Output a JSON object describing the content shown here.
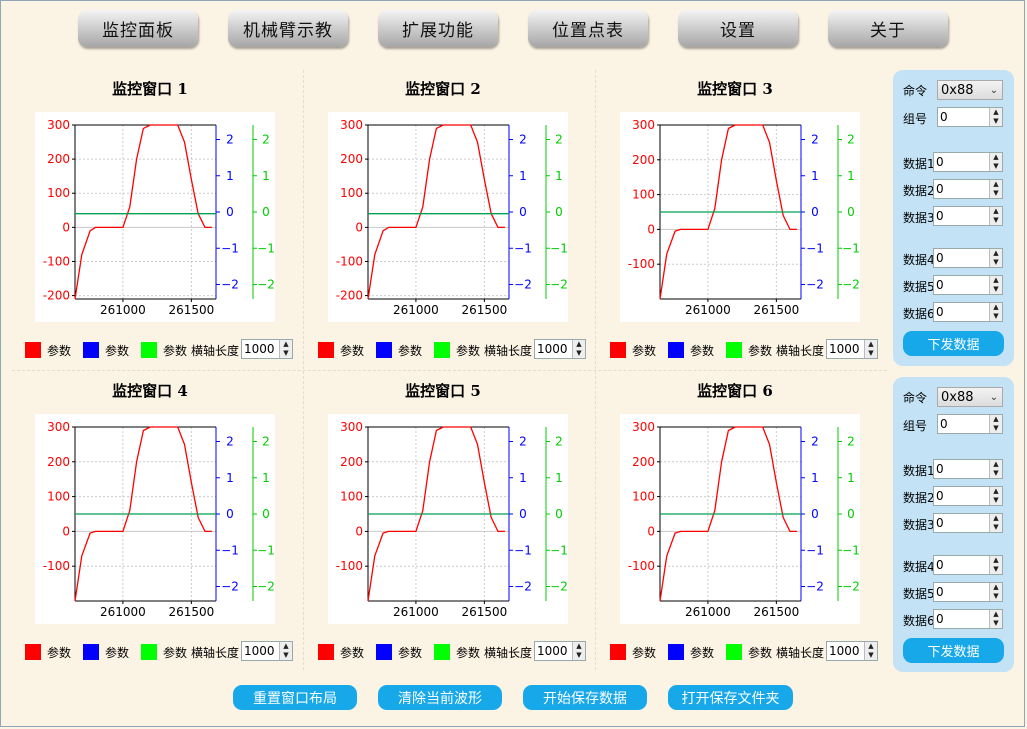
{
  "nav": [
    "监控面板",
    "机械臂示教",
    "扩展功能",
    "位置点表",
    "设置",
    "关于"
  ],
  "panels": [
    {
      "title": "监控窗口 1",
      "y_left": [
        "300",
        "200",
        "100",
        "0",
        "-100",
        "-200"
      ],
      "x_ticks": [
        "261000",
        "261500"
      ],
      "span": "1000"
    },
    {
      "title": "监控窗口 2",
      "y_left": [
        "300",
        "200",
        "100",
        "0",
        "-100",
        "-200"
      ],
      "x_ticks": [
        "261000",
        "261500"
      ],
      "span": "1000"
    },
    {
      "title": "监控窗口 3",
      "y_left": [
        "300",
        "200",
        "100",
        "0",
        "-100"
      ],
      "x_ticks": [
        "261000",
        "261500"
      ],
      "span": "1000"
    },
    {
      "title": "监控窗口 4",
      "y_left": [
        "300",
        "200",
        "100",
        "0",
        "-100"
      ],
      "x_ticks": [
        "261000",
        "261500"
      ],
      "span": "1000"
    },
    {
      "title": "监控窗口 5",
      "y_left": [
        "300",
        "200",
        "100",
        "0",
        "-100"
      ],
      "x_ticks": [
        "261000",
        "261500"
      ],
      "span": "1000"
    },
    {
      "title": "监控窗口 6",
      "y_left": [
        "300",
        "200",
        "100",
        "0",
        "-100"
      ],
      "x_ticks": [
        "261000",
        "261500"
      ],
      "span": "1000"
    }
  ],
  "legend": {
    "series": [
      "参数",
      "参数",
      "参数"
    ],
    "colors": [
      "#ff0000",
      "#0000ff",
      "#00ff00"
    ],
    "span_label": "横轴长度"
  },
  "axis_blue": [
    "2",
    "1",
    "0",
    "−1",
    "−2"
  ],
  "axis_green": [
    "2",
    "1",
    "0",
    "−1",
    "−2"
  ],
  "side_panels": [
    {
      "cmd_label": "命令",
      "cmd_value": "0x88",
      "group_label": "组号",
      "group_value": "0",
      "data": [
        {
          "label": "数据1",
          "value": "0"
        },
        {
          "label": "数据2",
          "value": "0"
        },
        {
          "label": "数据3",
          "value": "0"
        },
        {
          "label": "数据4",
          "value": "0"
        },
        {
          "label": "数据5",
          "value": "0"
        },
        {
          "label": "数据6",
          "value": "0"
        }
      ],
      "send": "下发数据"
    },
    {
      "cmd_label": "命令",
      "cmd_value": "0x88",
      "group_label": "组号",
      "group_value": "0",
      "data": [
        {
          "label": "数据1",
          "value": "0"
        },
        {
          "label": "数据2",
          "value": "0"
        },
        {
          "label": "数据3",
          "value": "0"
        },
        {
          "label": "数据4",
          "value": "0"
        },
        {
          "label": "数据5",
          "value": "0"
        },
        {
          "label": "数据6",
          "value": "0"
        }
      ],
      "send": "下发数据"
    }
  ],
  "bottom": [
    "重置窗口布局",
    "清除当前波形",
    "开始保存数据",
    "打开保存文件夹"
  ],
  "chart_data": [
    {
      "type": "line",
      "title": "监控窗口 1",
      "x_ticks": [
        261000,
        261500
      ],
      "xlim": [
        260650,
        261680
      ],
      "ylim": [
        -210,
        300
      ],
      "y2lim": [
        -2.4,
        2.4
      ],
      "series": [
        {
          "name": "参数",
          "color": "#ff0000",
          "points": [
            [
              260650,
              -210
            ],
            [
              260700,
              -80
            ],
            [
              260760,
              -10
            ],
            [
              260800,
              0
            ],
            [
              261000,
              0
            ],
            [
              261050,
              60
            ],
            [
              261100,
              200
            ],
            [
              261150,
              290
            ],
            [
              261200,
              300
            ],
            [
              261400,
              300
            ],
            [
              261450,
              250
            ],
            [
              261500,
              140
            ],
            [
              261550,
              40
            ],
            [
              261600,
              0
            ],
            [
              261650,
              0
            ]
          ]
        },
        {
          "name": "参数",
          "color": "#0000ff",
          "points": []
        },
        {
          "name": "参数",
          "color": "#00aa00",
          "points": [
            [
              260650,
              0.0
            ],
            [
              261650,
              0.0
            ]
          ]
        }
      ]
    },
    {
      "type": "line",
      "title": "监控窗口 2",
      "x_ticks": [
        261000,
        261500
      ],
      "xlim": [
        260650,
        261680
      ],
      "ylim": [
        -210,
        300
      ],
      "y2lim": [
        -2.4,
        2.4
      ],
      "series": [
        {
          "name": "参数",
          "color": "#ff0000",
          "points": [
            [
              260650,
              -210
            ],
            [
              260700,
              -80
            ],
            [
              260760,
              -10
            ],
            [
              260800,
              0
            ],
            [
              261000,
              0
            ],
            [
              261050,
              60
            ],
            [
              261100,
              200
            ],
            [
              261150,
              290
            ],
            [
              261200,
              300
            ],
            [
              261400,
              300
            ],
            [
              261450,
              250
            ],
            [
              261500,
              140
            ],
            [
              261550,
              40
            ],
            [
              261600,
              0
            ],
            [
              261650,
              0
            ]
          ]
        },
        {
          "name": "参数",
          "color": "#0000ff",
          "points": []
        },
        {
          "name": "参数",
          "color": "#00aa00",
          "points": [
            [
              260650,
              0.0
            ],
            [
              261650,
              0.0
            ]
          ]
        }
      ]
    },
    {
      "type": "line",
      "title": "监控窗口 3",
      "x_ticks": [
        261000,
        261500
      ],
      "xlim": [
        260650,
        261680
      ],
      "ylim": [
        -200,
        300
      ],
      "y2lim": [
        -2.4,
        2.4
      ],
      "series": [
        {
          "name": "参数",
          "color": "#ff0000",
          "points": [
            [
              260650,
              -200
            ],
            [
              260700,
              -70
            ],
            [
              260760,
              -5
            ],
            [
              260800,
              0
            ],
            [
              261000,
              0
            ],
            [
              261050,
              60
            ],
            [
              261100,
              200
            ],
            [
              261150,
              290
            ],
            [
              261200,
              300
            ],
            [
              261400,
              300
            ],
            [
              261450,
              250
            ],
            [
              261500,
              140
            ],
            [
              261550,
              40
            ],
            [
              261600,
              0
            ],
            [
              261650,
              0
            ]
          ]
        },
        {
          "name": "参数",
          "color": "#0000ff",
          "points": []
        },
        {
          "name": "参数",
          "color": "#00aa00",
          "points": [
            [
              260650,
              0.0
            ],
            [
              261650,
              0.0
            ]
          ]
        }
      ]
    },
    {
      "type": "line",
      "title": "监控窗口 4",
      "x_ticks": [
        261000,
        261500
      ],
      "xlim": [
        260650,
        261680
      ],
      "ylim": [
        -200,
        300
      ],
      "y2lim": [
        -2.4,
        2.4
      ],
      "series": [
        {
          "name": "参数",
          "color": "#ff0000",
          "points": [
            [
              260650,
              -200
            ],
            [
              260700,
              -70
            ],
            [
              260760,
              -5
            ],
            [
              260800,
              0
            ],
            [
              261000,
              0
            ],
            [
              261050,
              60
            ],
            [
              261100,
              200
            ],
            [
              261150,
              290
            ],
            [
              261200,
              300
            ],
            [
              261400,
              300
            ],
            [
              261450,
              250
            ],
            [
              261500,
              140
            ],
            [
              261550,
              40
            ],
            [
              261600,
              0
            ],
            [
              261650,
              0
            ]
          ]
        },
        {
          "name": "参数",
          "color": "#0000ff",
          "points": []
        },
        {
          "name": "参数",
          "color": "#00aa00",
          "points": [
            [
              260650,
              0.0
            ],
            [
              261650,
              0.0
            ]
          ]
        }
      ]
    },
    {
      "type": "line",
      "title": "监控窗口 5",
      "x_ticks": [
        261000,
        261500
      ],
      "xlim": [
        260650,
        261680
      ],
      "ylim": [
        -200,
        300
      ],
      "y2lim": [
        -2.4,
        2.4
      ],
      "series": [
        {
          "name": "参数",
          "color": "#ff0000",
          "points": [
            [
              260650,
              -200
            ],
            [
              260700,
              -70
            ],
            [
              260760,
              -5
            ],
            [
              260800,
              0
            ],
            [
              261000,
              0
            ],
            [
              261050,
              60
            ],
            [
              261100,
              200
            ],
            [
              261150,
              290
            ],
            [
              261200,
              300
            ],
            [
              261400,
              300
            ],
            [
              261450,
              250
            ],
            [
              261500,
              140
            ],
            [
              261550,
              40
            ],
            [
              261600,
              0
            ],
            [
              261650,
              0
            ]
          ]
        },
        {
          "name": "参数",
          "color": "#0000ff",
          "points": []
        },
        {
          "name": "参数",
          "color": "#00aa00",
          "points": [
            [
              260650,
              0.0
            ],
            [
              261650,
              0.0
            ]
          ]
        }
      ]
    },
    {
      "type": "line",
      "title": "监控窗口 6",
      "x_ticks": [
        261000,
        261500
      ],
      "xlim": [
        260650,
        261680
      ],
      "ylim": [
        -200,
        300
      ],
      "y2lim": [
        -2.4,
        2.4
      ],
      "series": [
        {
          "name": "参数",
          "color": "#ff0000",
          "points": [
            [
              260650,
              -200
            ],
            [
              260700,
              -70
            ],
            [
              260760,
              -5
            ],
            [
              260800,
              0
            ],
            [
              261000,
              0
            ],
            [
              261050,
              60
            ],
            [
              261100,
              200
            ],
            [
              261150,
              290
            ],
            [
              261200,
              300
            ],
            [
              261400,
              300
            ],
            [
              261450,
              250
            ],
            [
              261500,
              140
            ],
            [
              261550,
              40
            ],
            [
              261600,
              0
            ],
            [
              261650,
              0
            ]
          ]
        },
        {
          "name": "参数",
          "color": "#0000ff",
          "points": []
        },
        {
          "name": "参数",
          "color": "#00aa00",
          "points": [
            [
              260650,
              0.0
            ],
            [
              261650,
              0.0
            ]
          ]
        }
      ]
    }
  ]
}
